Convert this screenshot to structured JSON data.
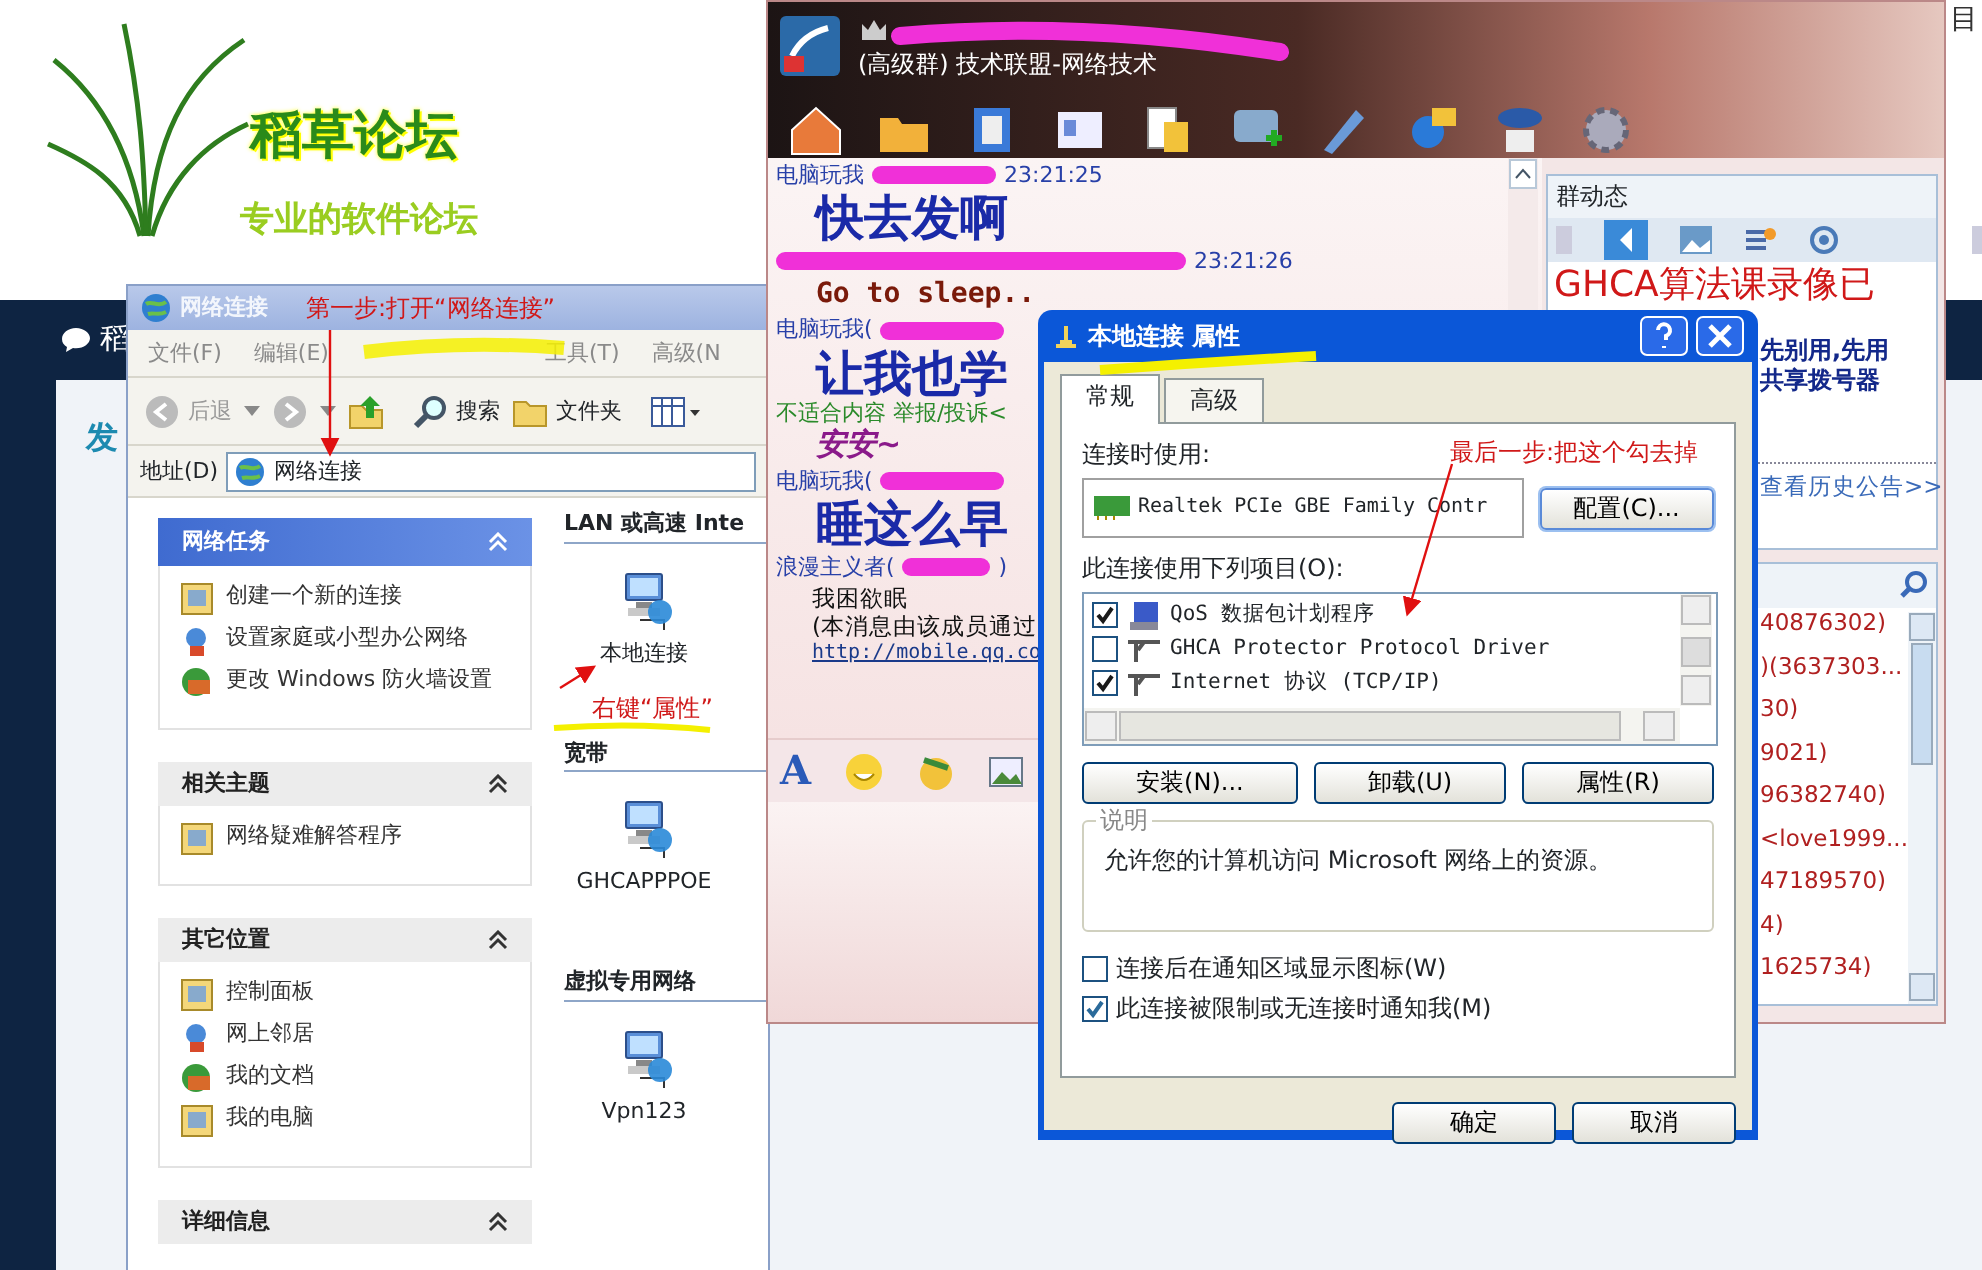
{
  "forum_page": {
    "corner_text": "目",
    "logo_title": "稻草论坛",
    "logo_subtitle": "专业的软件论坛",
    "nav_text": "稻",
    "heading_text": "发"
  },
  "network_window": {
    "title": "网络连接",
    "menu": [
      "文件(F)",
      "编辑(E)",
      "工具(T)",
      "高级(N"
    ],
    "toolbar": {
      "back": {
        "label": "后退",
        "disabled": true
      },
      "search": "搜索",
      "folders": "文件夹"
    },
    "address": {
      "label": "地址(D)",
      "value": "网络连接"
    },
    "task_panels": [
      {
        "title": "网络任务",
        "kind": "primary",
        "items": [
          "创建一个新的连接",
          "设置家庭或小型办公网络",
          "更改 Windows 防火墙设置"
        ]
      },
      {
        "title": "相关主题",
        "kind": "secondary",
        "items": [
          "网络疑难解答程序"
        ]
      },
      {
        "title": "其它位置",
        "kind": "secondary",
        "items": [
          "控制面板",
          "网上邻居",
          "我的文档",
          "我的电脑"
        ]
      },
      {
        "title": "详细信息",
        "kind": "secondary"
      }
    ],
    "sections": [
      {
        "title": "LAN 或高速 Inte",
        "connections": [
          "本地连接"
        ]
      },
      {
        "title": "宽带",
        "connections": [
          "GHCAPPPOE"
        ]
      },
      {
        "title": "虚拟专用网络",
        "connections": [
          "Vpn123"
        ]
      }
    ]
  },
  "qq_window": {
    "group_name": "(高级群) 技术联盟-网络技术",
    "messages": [
      {
        "kind": "header",
        "sender": "电脑玩我",
        "time": "23:21:25"
      },
      {
        "kind": "large",
        "text": "快去发啊"
      },
      {
        "kind": "header",
        "time": "23:21:26"
      },
      {
        "kind": "mono",
        "text": "Go to sleep.."
      },
      {
        "kind": "header",
        "sender": "电脑玩我("
      },
      {
        "kind": "large",
        "text": "让我也学"
      },
      {
        "kind": "notice",
        "text": "不适合内容 举报/投诉<"
      },
      {
        "kind": "styled",
        "text": "安安~"
      },
      {
        "kind": "header",
        "sender": "电脑玩我("
      },
      {
        "kind": "large",
        "text": "睡这么早"
      },
      {
        "kind": "header",
        "sender": "浪漫主义者(",
        "suffix": ")"
      },
      {
        "kind": "plain",
        "text": "我困欲眠"
      },
      {
        "kind": "plain",
        "text": "(本消息由该成员通过"
      },
      {
        "kind": "link",
        "text": "http://mobile.qq.co"
      }
    ],
    "input_toolbar": {
      "font_button": "A"
    },
    "group_news": {
      "title": "群动态",
      "headline": "GHCA算法课录像已",
      "lines": [
        "先别用,先用",
        "共享拨号器"
      ],
      "history_link": "查看历史公告>>"
    },
    "members": [
      "40876302)",
      ")(3637303...",
      "30)",
      "9021)",
      "96382740)",
      "<love1999...",
      "47189570)",
      "4)",
      "1625734)"
    ]
  },
  "properties_dialog": {
    "title": "本地连接 属性",
    "tabs": [
      {
        "label": "常规",
        "selected": true
      },
      {
        "label": "高级",
        "selected": false
      }
    ],
    "connect_using_label": "连接时使用:",
    "adapter": "Realtek PCIe GBE Family Contr",
    "configure_button": "配置(C)...",
    "components_label": "此连接使用下列项目(O):",
    "components": [
      {
        "label": "QoS 数据包计划程序",
        "checked": true
      },
      {
        "label": "GHCA Protector Protocol Driver",
        "checked": false
      },
      {
        "label": "Internet 协议 (TCP/IP)",
        "checked": true
      }
    ],
    "action_buttons": [
      "安装(N)...",
      "卸载(U)",
      "属性(R)"
    ],
    "description_label": "说明",
    "description": "允许您的计算机访问 Microsoft 网络上的资源。",
    "options": [
      {
        "label": "连接后在通知区域显示图标(W)",
        "checked": false
      },
      {
        "label": "此连接被限制或无连接时通知我(M)",
        "checked": true
      }
    ],
    "buttons": [
      "确定",
      "取消"
    ]
  },
  "annotations": [
    "第一步:打开“网络连接”",
    "右键“属性”",
    "最后一步:把这个勾去掉"
  ]
}
